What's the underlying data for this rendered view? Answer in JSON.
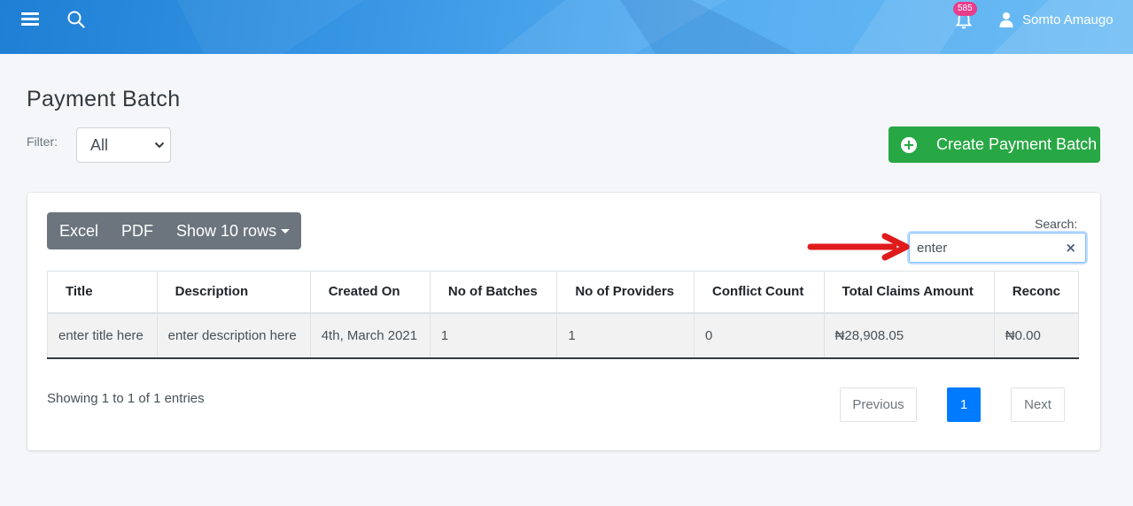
{
  "header": {
    "notification_count": "585",
    "user_name": "Somto Amaugo",
    "brand_color": "#2f8fe0"
  },
  "page": {
    "title": "Payment Batch",
    "filter_label": "Filter:",
    "filter_value": "All",
    "create_button_label": "Create Payment Batch"
  },
  "toolbar": {
    "excel_label": "Excel",
    "pdf_label": "PDF",
    "rows_label": "Show 10 rows"
  },
  "search": {
    "label": "Search:",
    "value": "enter",
    "clear_symbol": "×"
  },
  "table": {
    "columns": [
      "Title",
      "Description",
      "Created On",
      "No of Batches",
      "No of Providers",
      "Conflict Count",
      "Total Claims Amount",
      "Reconc"
    ],
    "rows": [
      [
        "enter title here",
        "enter description here",
        "4th, March 2021",
        "1",
        "1",
        "0",
        "₦28,908.05",
        "₦0.00"
      ]
    ]
  },
  "footer": {
    "info": "Showing 1 to 1 of 1 entries",
    "previous_label": "Previous",
    "current_page": "1",
    "next_label": "Next"
  },
  "annotation": {
    "arrow_color": "#e01b1b"
  }
}
